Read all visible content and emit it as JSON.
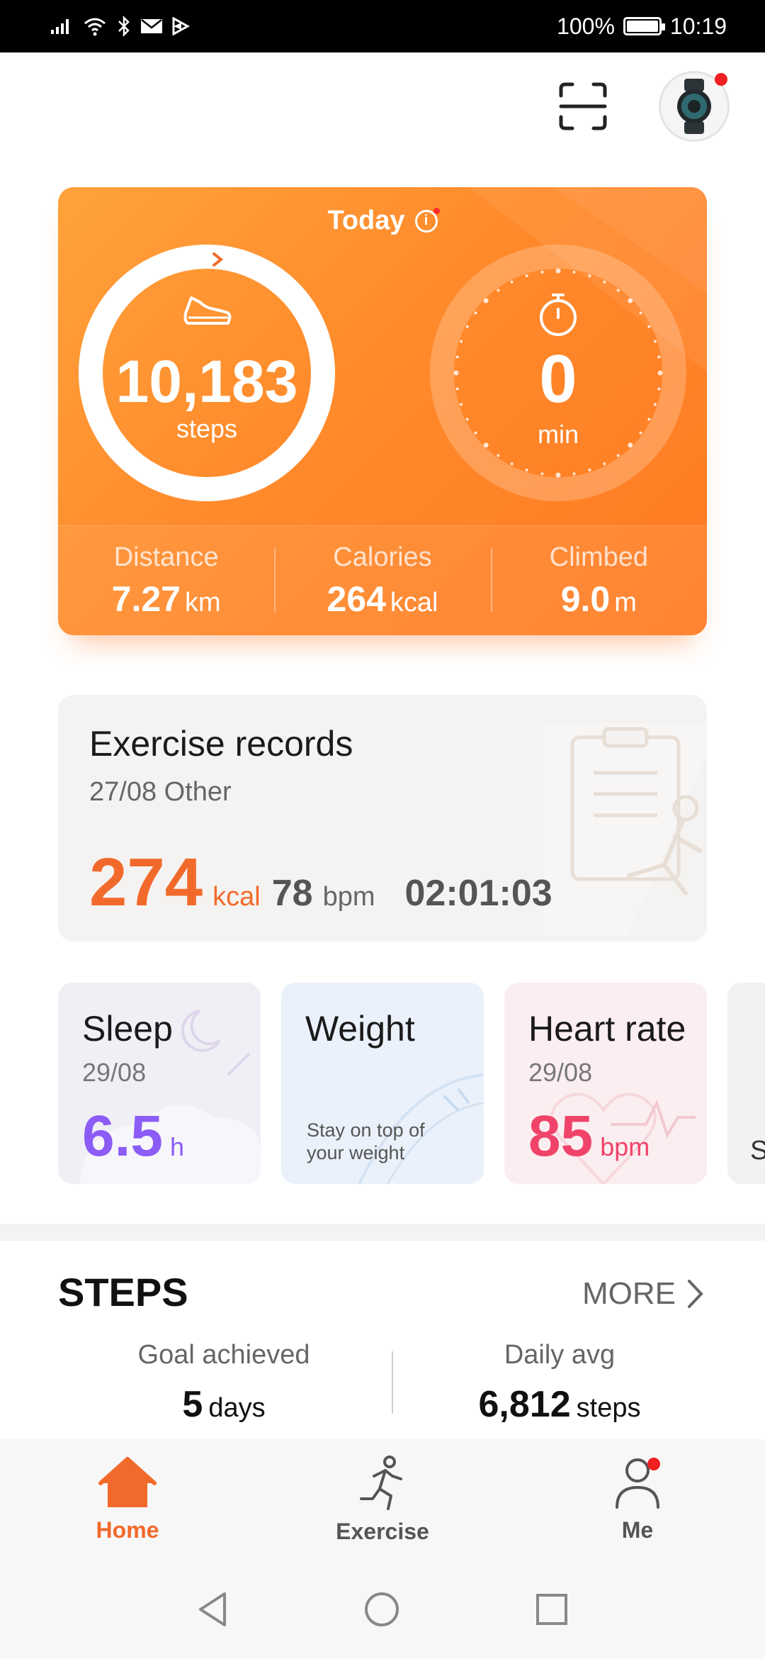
{
  "status_bar": {
    "battery": "100%",
    "time": "10:19"
  },
  "today": {
    "title": "Today",
    "steps_value": "10,183",
    "steps_unit": "steps",
    "steps_progress": 1.0,
    "time_value": "0",
    "time_unit": "min",
    "metrics": [
      {
        "label": "Distance",
        "value": "7.27",
        "unit": "km"
      },
      {
        "label": "Calories",
        "value": "264",
        "unit": "kcal"
      },
      {
        "label": "Climbed",
        "value": "9.0",
        "unit": "m"
      }
    ]
  },
  "exercise": {
    "title": "Exercise records",
    "subtitle": "27/08  Other",
    "kcal_value": "274",
    "kcal_unit": "kcal",
    "bpm_value": "78",
    "bpm_unit": "bpm",
    "duration": "02:01:03"
  },
  "cards": {
    "sleep": {
      "title": "Sleep",
      "date": "29/08",
      "value": "6.5",
      "unit": "h",
      "color": "#8b5cf6"
    },
    "weight": {
      "title": "Weight",
      "desc": "Stay on top of your weight"
    },
    "heart": {
      "title": "Heart rate",
      "date": "29/08",
      "value": "85",
      "unit": "bpm",
      "color": "#f0436a"
    },
    "partial": {
      "letter": "S"
    }
  },
  "steps_section": {
    "title": "STEPS",
    "more": "MORE",
    "goal_label": "Goal achieved",
    "goal_value": "5",
    "goal_unit": "days",
    "avg_label": "Daily avg",
    "avg_value": "6,812",
    "avg_unit": "steps"
  },
  "nav": {
    "home": "Home",
    "exercise": "Exercise",
    "me": "Me"
  },
  "colors": {
    "accent": "#f26a2b",
    "card_orange": "#ff8a2b"
  }
}
